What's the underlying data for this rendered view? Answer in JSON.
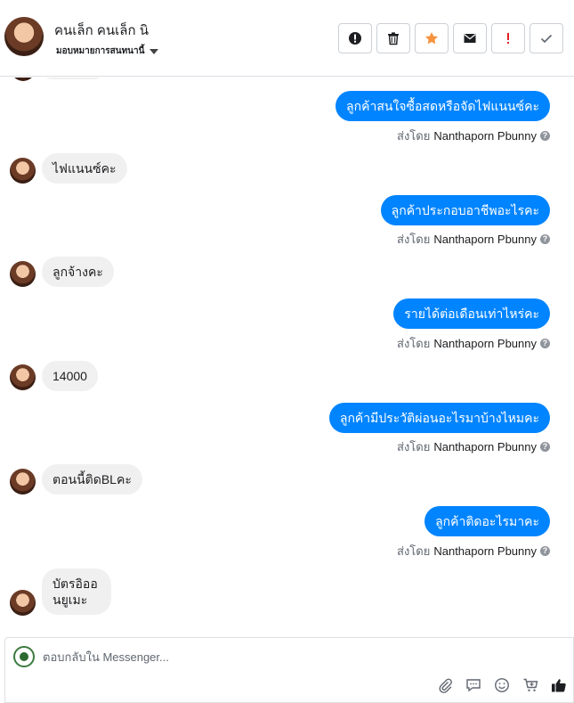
{
  "header": {
    "name": "คนเล็ก คนเล็ก นิ",
    "assign_label": "มอบหมายการสนทนานี้",
    "actions": [
      {
        "name": "alert-circle-icon",
        "color": "#1c1e21"
      },
      {
        "name": "trash-icon",
        "color": "#1c1e21"
      },
      {
        "name": "star-icon",
        "color": "#f7923b"
      },
      {
        "name": "envelope-icon",
        "color": "#1c1e21"
      },
      {
        "name": "exclamation-icon",
        "color": "#e02020"
      },
      {
        "name": "check-icon",
        "color": "#606770"
      }
    ]
  },
  "messages": [
    {
      "dir": "out",
      "text": "ลูกค้าสนใจซื้อสดหรือจัดไฟแนนซ์คะ",
      "sent_prefix": "ส่งโดย",
      "sender": "Nanthaporn Pbunny"
    },
    {
      "dir": "in",
      "text": "ไฟแนนซ์คะ"
    },
    {
      "dir": "out",
      "text": "ลูกค้าประกอบอาชีพอะไรคะ",
      "sent_prefix": "ส่งโดย",
      "sender": "Nanthaporn Pbunny"
    },
    {
      "dir": "in",
      "text": "ลูกจ้างคะ"
    },
    {
      "dir": "out",
      "text": "รายได้ต่อเดือนเท่าไหร่คะ",
      "sent_prefix": "ส่งโดย",
      "sender": "Nanthaporn Pbunny"
    },
    {
      "dir": "in",
      "text": "14000"
    },
    {
      "dir": "out",
      "text": "ลูกค้ามีประวัติผ่อนอะไรมาบ้างไหมคะ",
      "sent_prefix": "ส่งโดย",
      "sender": "Nanthaporn Pbunny"
    },
    {
      "dir": "in",
      "text": "ตอนนี้ติดBLคะ"
    },
    {
      "dir": "out",
      "text": "ลูกค้าติดอะไรมาคะ",
      "sent_prefix": "ส่งโดย",
      "sender": "Nanthaporn Pbunny"
    },
    {
      "dir": "in",
      "text": "บัตรอิออนยูเมะ"
    }
  ],
  "composer": {
    "placeholder": "ตอบกลับใน Messenger...",
    "tools": [
      "paperclip-icon",
      "speech-bubble-icon",
      "emoji-icon",
      "cart-icon",
      "thumbs-up-icon"
    ]
  }
}
